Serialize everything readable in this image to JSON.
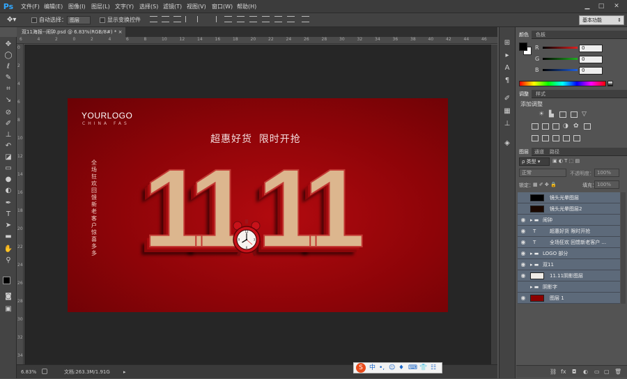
{
  "app": {
    "logo": "Ps"
  },
  "menu": [
    "文件(F)",
    "编辑(E)",
    "图像(I)",
    "图层(L)",
    "文字(Y)",
    "选择(S)",
    "滤镜(T)",
    "视图(V)",
    "窗口(W)",
    "帮助(H)"
  ],
  "window_controls": {
    "minimize": "▁",
    "restore": "□",
    "close": "✕"
  },
  "options": {
    "auto_select_label": "自动选择：",
    "auto_select_value": "图层",
    "show_transform_label": "显示变换控件",
    "workspace": "基本功能"
  },
  "document_tab": "双11海报--闹钟.psd @ 6.83%(RGB/8#) * ×",
  "ruler_top": [
    "6",
    "4",
    "2",
    "0",
    "2",
    "4",
    "6",
    "8",
    "10",
    "12",
    "14",
    "16",
    "18",
    "20",
    "22",
    "24",
    "26",
    "28",
    "30",
    "32",
    "34",
    "36",
    "38",
    "40",
    "42",
    "44",
    "46"
  ],
  "ruler_left": [
    "0",
    "2",
    "4",
    "6",
    "8",
    "10",
    "12",
    "14",
    "16",
    "18",
    "20",
    "22",
    "24",
    "26",
    "28",
    "30",
    "32",
    "34"
  ],
  "artboard": {
    "logo": "YOURLOGO",
    "logo_sub": "CHINA FAS",
    "slogan": "超惠好货  限时开抢",
    "vertical_text": "全场狂欢 回馈新老客户 惊喜多多",
    "digits_left": "11",
    "digits_right": "11",
    "clock_numbers": [
      "12",
      "3",
      "6",
      "9"
    ]
  },
  "status": {
    "zoom": "6.83%",
    "doc": "文档:263.3M/1.91G"
  },
  "taskbar": [
    "S",
    "中",
    "•,",
    "☺",
    "♦",
    "⌨",
    "👕",
    "☷"
  ],
  "color_panel": {
    "tabs": [
      "颜色",
      "色板"
    ],
    "r_label": "R",
    "g_label": "G",
    "b_label": "B",
    "r": "0",
    "g": "0",
    "b": "0",
    "colors": {
      "r": "#e02020",
      "g": "#20b020",
      "b": "#2060e0"
    }
  },
  "adjust_panel": {
    "tabs": [
      "调整",
      "样式"
    ],
    "title": "添加调整"
  },
  "layers_panel": {
    "tabs": [
      "图层",
      "通道",
      "路径"
    ],
    "filter": "ρ 类型",
    "blend": "正常",
    "opacity_label": "不透明度：",
    "opacity": "100%",
    "lock_label": "锁定：",
    "fill_label": "填充：",
    "fill": "100%",
    "layers": [
      {
        "name": "镜头光晕图层",
        "visible": false,
        "kind": "thumb",
        "thumb": "#000000"
      },
      {
        "name": "镜头光晕图层2",
        "visible": false,
        "kind": "thumb",
        "thumb": "#1a0800"
      },
      {
        "name": "闹钟",
        "visible": true,
        "kind": "folder"
      },
      {
        "name": "超惠好货  限时开抢",
        "visible": true,
        "kind": "text"
      },
      {
        "name": "全场狂欢  回馈新老客户 ...",
        "visible": true,
        "kind": "text"
      },
      {
        "name": "LOGO 部分",
        "visible": true,
        "kind": "folder"
      },
      {
        "name": "双11",
        "visible": true,
        "kind": "folder"
      },
      {
        "name": "11.11阴影图层",
        "visible": true,
        "kind": "thumb",
        "thumb": "#f0ece6"
      },
      {
        "name": "阴影字",
        "visible": false,
        "kind": "folder"
      },
      {
        "name": "图层 1",
        "visible": true,
        "kind": "thumb",
        "thumb": "#8b0000"
      }
    ]
  }
}
